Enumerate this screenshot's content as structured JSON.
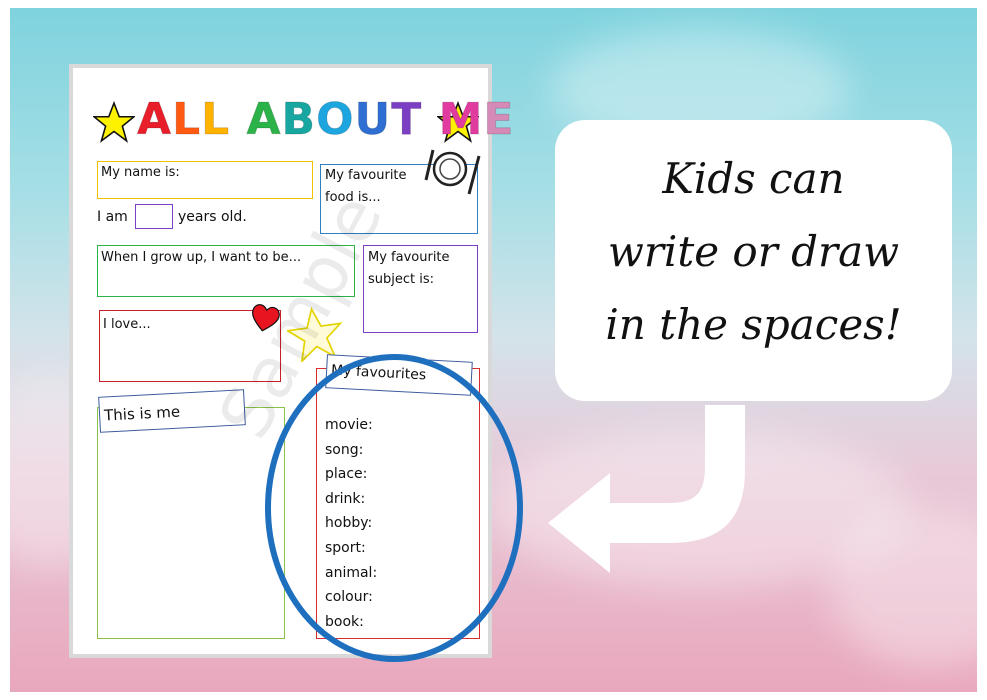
{
  "worksheet": {
    "title_letters": [
      "A",
      "L",
      "L",
      " ",
      "A",
      "B",
      "O",
      "U",
      "T",
      " ",
      "M",
      "E"
    ],
    "title_colors": [
      "#e91e2b",
      "#ff5a12",
      "#ffb200",
      "#ffffff",
      "#2bb34a",
      "#17a7a0",
      "#1da5e0",
      "#2f6fd3",
      "#7b3fc4",
      "#ffffff",
      "#e23ba0",
      "#d68ab7"
    ],
    "name_label": "My name is:",
    "age_prefix": "I am",
    "age_suffix": "years old.",
    "food_label_line1": "My favourite",
    "food_label_line2": "food is...",
    "grow_up_label": "When I grow up, I want to be...",
    "subject_label_line1": "My favourite",
    "subject_label_line2": "subject is:",
    "love_label": "I love...",
    "this_is_me_label": "This is me",
    "favourites_label": "My favourites",
    "favourites_items": [
      "movie:",
      "song:",
      "place:",
      "drink:",
      "hobby:",
      "sport:",
      "animal:",
      "colour:",
      "book:"
    ],
    "watermark": "Sample",
    "box_colors": {
      "name": "#f2c200",
      "age": "#7b3fc4",
      "food": "#2f7fc4",
      "grow_up": "#2bb34a",
      "subject": "#7b3fc4",
      "love": "#c8202a",
      "this_is_me": "#8bc34a",
      "favourites": "#d92b2b",
      "highlight_ellipse": "#1f6fbf"
    },
    "icons": [
      "star-icon",
      "plate-cutlery-icon",
      "heart-icon",
      "star-outline-icon"
    ]
  },
  "callout": {
    "line1": "Kids can",
    "line2": "write or draw",
    "line3": "in the spaces!"
  },
  "colors": {
    "star_fill": "#fff200",
    "heart_fill": "#e8141f",
    "arrow": "#ffffff"
  }
}
